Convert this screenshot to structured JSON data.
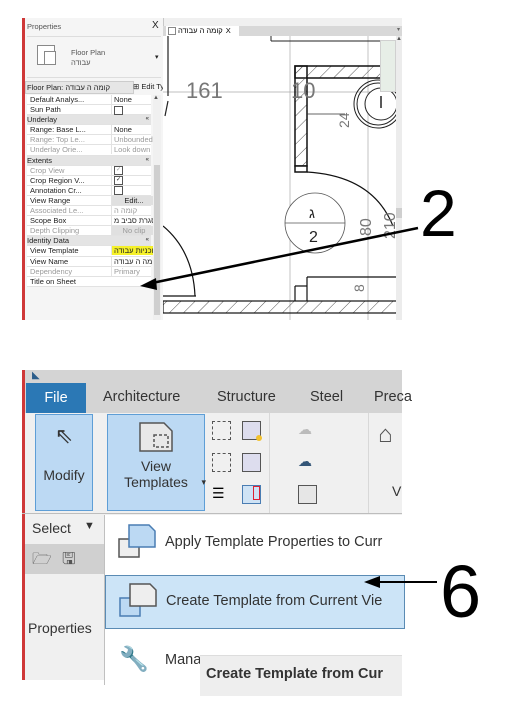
{
  "top_screenshot": {
    "properties_panel": {
      "title": "Properties",
      "close_glyph": "X",
      "type_name_line1": "Floor Plan",
      "type_name_line2": "עבודה",
      "type_selector": "Floor Plan: קומה ה עבודה",
      "edit_type_label": "Edit Type",
      "rows": [
        {
          "type": "prop",
          "key": "Default Analys...",
          "value": "None"
        },
        {
          "type": "prop",
          "key": "Sun Path",
          "value": "checkbox-unchecked"
        },
        {
          "type": "section",
          "key": "Underlay"
        },
        {
          "type": "prop",
          "key": "Range: Base L...",
          "value": "None"
        },
        {
          "type": "prop",
          "key": "Range: Top Le...",
          "value": "Unbounded",
          "dim": true
        },
        {
          "type": "prop",
          "key": "Underlay Orie...",
          "value": "Look down",
          "dim": true
        },
        {
          "type": "section",
          "key": "Extents"
        },
        {
          "type": "prop",
          "key": "Crop View",
          "value": "checkbox-checked",
          "dim": true
        },
        {
          "type": "prop",
          "key": "Crop Region V...",
          "value": "checkbox-checked"
        },
        {
          "type": "prop",
          "key": "Annotation Cr...",
          "value": "checkbox-unchecked"
        },
        {
          "type": "prop",
          "key": "View Range",
          "value": "Edit..."
        },
        {
          "type": "prop",
          "key": "Associated Le...",
          "value": "קומה ה",
          "dim": true
        },
        {
          "type": "prop",
          "key": "Scope Box",
          "value": "מסגרת סביב מ..."
        },
        {
          "type": "prop",
          "key": "Depth Clipping",
          "value": "No clip",
          "dim": true
        },
        {
          "type": "section",
          "key": "Identity Data"
        },
        {
          "type": "prop",
          "key": "View Template",
          "value": "תוכניות עבודה",
          "highlight": true
        },
        {
          "type": "prop",
          "key": "View Name",
          "value": "קומה ה עבודה"
        },
        {
          "type": "prop",
          "key": "Dependency",
          "value": "Primary",
          "dim": true
        },
        {
          "type": "prop",
          "key": "Title on Sheet",
          "value": ""
        }
      ]
    },
    "view_tab": {
      "label": "קומה ה עבודה",
      "close_glyph": "X"
    },
    "drawing": {
      "dim_161": "161",
      "dim_10": "10",
      "dim_24": "24",
      "door_tag_top": "ג",
      "door_tag_bottom": "2",
      "dim_80": "80",
      "dim_210": "210",
      "dim_8": "8"
    },
    "callout_number": "2"
  },
  "bottom_screenshot": {
    "ribbon_tabs": [
      "File",
      "Architecture",
      "Structure",
      "Steel",
      "Preca"
    ],
    "modify_label": "Modify",
    "view_templates_line1": "View",
    "view_templates_line2": "Templates",
    "select_label": "Select",
    "properties_label": "Properties",
    "partial_button_label": "V",
    "dropdown_items": [
      {
        "label": "Apply Template Properties to Curr"
      },
      {
        "label": "Create Template from Current Vie",
        "active": true
      },
      {
        "label": "Mana"
      }
    ],
    "tooltip_text": "Create Template from Cur",
    "callout_number": "6",
    "colors": {
      "file_tab": "#2b78b5",
      "highlight_blue": "#cce4f7",
      "active_button": "#bcd9f3"
    }
  }
}
